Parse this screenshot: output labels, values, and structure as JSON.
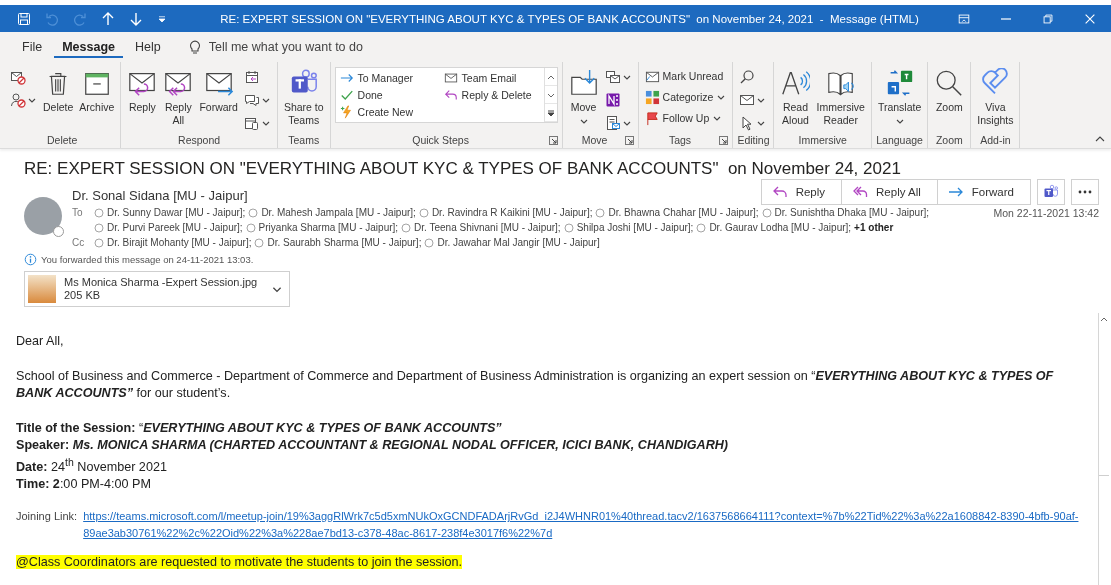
{
  "window": {
    "title": "RE: EXPERT SESSION ON \"EVERYTHING ABOUT KYC & TYPES OF BANK ACCOUNTS\"  on November 24, 2021  -  Message (HTML)",
    "quick_access": [
      {
        "disabled": false
      },
      {
        "disabled": true
      },
      {
        "disabled": true
      },
      {
        "disabled": false
      },
      {
        "disabled": false
      }
    ]
  },
  "tabs": [
    {
      "label": "File",
      "selected": false
    },
    {
      "label": "Message",
      "selected": true
    },
    {
      "label": "Help",
      "selected": false
    }
  ],
  "tell_me": {
    "placeholder": "Tell me what you want to do"
  },
  "ribbon": {
    "groups": [
      {
        "label": "Delete",
        "launcher": false,
        "items": [
          {
            "kind": "icons"
          },
          {
            "kind": "large",
            "label": "Delete",
            "dropdown": false
          },
          {
            "kind": "large",
            "label": "Archive",
            "dropdown": false
          }
        ]
      },
      {
        "label": "Respond",
        "launcher": false,
        "items": [
          {
            "kind": "large",
            "label": "Reply",
            "dropdown": false
          },
          {
            "kind": "large",
            "label": "Reply\nAll",
            "dropdown": false
          },
          {
            "kind": "large",
            "label": "Forward",
            "dropdown": false
          },
          {
            "kind": "icons"
          }
        ]
      },
      {
        "label": "Teams",
        "launcher": false,
        "items": [
          {
            "kind": "large",
            "label": "Share to\nTeams",
            "dropdown": false
          }
        ]
      },
      {
        "label": "Quick Steps",
        "launcher": true,
        "items": [
          {
            "kind": "gallery",
            "entries": [
              "To Manager",
              "Team Email",
              "Done",
              "Reply & Delete",
              "Create New"
            ]
          }
        ]
      },
      {
        "label": "Move",
        "launcher": true,
        "items": [
          {
            "kind": "large",
            "label": "Move",
            "dropdown": true
          },
          {
            "kind": "icons"
          }
        ]
      },
      {
        "label": "Tags",
        "launcher": true,
        "items": [
          {
            "kind": "small",
            "label": "Mark Unread",
            "dropdown": false
          },
          {
            "kind": "small",
            "label": "Categorize",
            "dropdown": true
          },
          {
            "kind": "small",
            "label": "Follow Up",
            "dropdown": true
          }
        ]
      },
      {
        "label": "Editing",
        "launcher": false,
        "items": [
          {
            "kind": "icons"
          }
        ]
      },
      {
        "label": "Immersive",
        "launcher": false,
        "items": [
          {
            "kind": "large",
            "label": "Read\nAloud",
            "dropdown": false
          },
          {
            "kind": "large",
            "label": "Immersive\nReader",
            "dropdown": false
          }
        ]
      },
      {
        "label": "Language",
        "launcher": false,
        "items": [
          {
            "kind": "large",
            "label": "Translate",
            "dropdown": true
          }
        ]
      },
      {
        "label": "Zoom",
        "launcher": false,
        "items": [
          {
            "kind": "large",
            "label": "Zoom",
            "dropdown": false
          }
        ]
      },
      {
        "label": "Add-in",
        "launcher": false,
        "items": [
          {
            "kind": "large",
            "label": "Viva\nInsights",
            "dropdown": false
          }
        ]
      }
    ]
  },
  "message": {
    "subject": "RE: EXPERT SESSION ON \"EVERYTHING ABOUT KYC & TYPES OF BANK ACCOUNTS\"  on November 24, 2021",
    "actions": [
      "Reply",
      "Reply All",
      "Forward"
    ],
    "sender": "Dr. Sonal Sidana [MU - Jaipur]",
    "to_label": "To",
    "to": [
      "Dr. Sunny Dawar [MU - Jaipur];",
      "Dr. Mahesh Jampala [MU - Jaipur];",
      "Dr. Ravindra R Kaikini [MU - Jaipur];",
      "Dr. Bhawna Chahar [MU - Jaipur];",
      "Dr. Sunishtha Dhaka [MU - Jaipur];",
      "Dr. Purvi Pareek [MU - Jaipur];",
      "Priyanka Sharma [MU - Jaipur];",
      "Dr. Teena Shivnani [MU - Jaipur];",
      "Shilpa Joshi [MU - Jaipur];",
      "Dr. Gaurav Lodha [MU - Jaipur];"
    ],
    "to_more": "+1 other",
    "cc_label": "Cc",
    "cc": [
      "Dr. Birajit Mohanty [MU - Jaipur];",
      "Dr. Saurabh Sharma [MU - Jaipur];",
      "Dr. Jawahar Mal Jangir [MU - Jaipur]"
    ],
    "date": "Mon 22-11-2021 13:42",
    "info": "You forwarded this message on 24-11-2021 13:03.",
    "attachment": {
      "name": "Ms Monica Sharma -Expert Session.jpg",
      "size": "205 KB"
    }
  },
  "body": [
    {
      "kind": "text",
      "text": "Dear All,"
    },
    {
      "kind": "text",
      "text": "School of Business and Commerce - Department of Commerce and Department of Business Administration is organizing an expert session on “*EVERYTHING ABOUT KYC & TYPES OF BANK ACCOUNTS”* for our student’s."
    },
    {
      "kind": "details",
      "lines": [
        "**Title of the Session:** “*EVERYTHING ABOUT KYC & TYPES OF BANK ACCOUNTS”*",
        "**Speaker:** *Ms. MONICA SHARMA (CHARTED ACCOUNTANT & REGIONAL NODAL OFFICER, ICICI BANK, CHANDIGARH)*",
        "**Date:** 24$^{th}$ November 2021",
        "**Time: 2**:00 PM-4:00 PM"
      ]
    },
    {
      "kind": "link",
      "label": "Joining Link:",
      "url": "https://teams.microsoft.com/l/meetup-join/19%3aggRlWrk7c5d5xmNUkOxGCNDFADArjRvGd_i2J4WHNR01%40thread.tacv2/1637568664111?context=%7b%22Tid%22%3a%22a1608842-8390-4bfb-90af-89ae3ab30761%22%2c%22Oid%22%3a%228ae7bd13-c378-48ac-8617-238f4e3017f6%22%7d"
    },
    {
      "kind": "highlight",
      "text": "@Class Coordinators are requested to motivate the students to join the session."
    }
  ]
}
